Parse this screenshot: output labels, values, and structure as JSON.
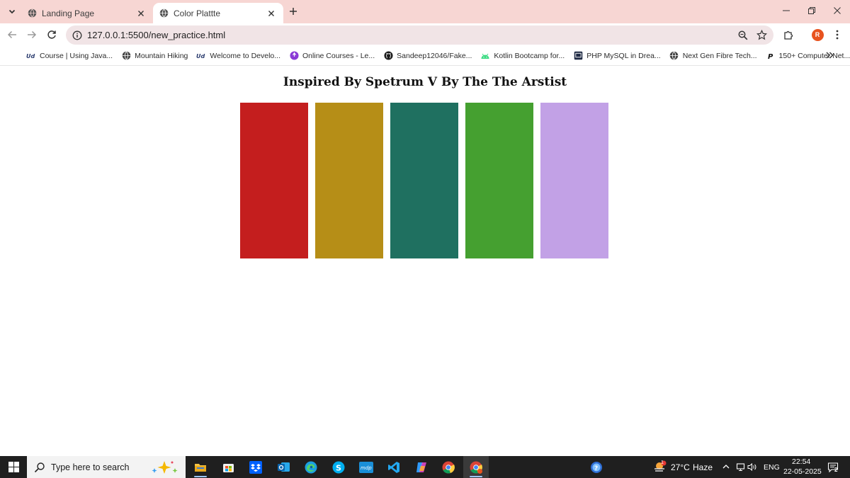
{
  "browser": {
    "tabs": [
      {
        "title": "Landing Page",
        "active": false
      },
      {
        "title": "Color Plattte",
        "active": true
      }
    ],
    "url": "127.0.0.1:5500/new_practice.html",
    "profile_initial": "R",
    "bookmarks": [
      {
        "label": "Course | Using Java...",
        "icon": "udemy-icon"
      },
      {
        "label": "Mountain Hiking",
        "icon": "globe-icon"
      },
      {
        "label": "Welcome to Develo...",
        "icon": "udemy-icon"
      },
      {
        "label": "Online Courses - Le...",
        "icon": "udemy-purple-icon"
      },
      {
        "label": "Sandeep12046/Fake...",
        "icon": "github-icon"
      },
      {
        "label": "Kotlin Bootcamp for...",
        "icon": "android-icon"
      },
      {
        "label": "PHP MySQL in Drea...",
        "icon": "screen-icon"
      },
      {
        "label": "Next Gen Fibre Tech...",
        "icon": "globe-icon"
      },
      {
        "label": "150+ Computer Net...",
        "icon": "p-icon"
      }
    ]
  },
  "page": {
    "title": "Inspired By Spetrum V By The The Arstist",
    "swatches": [
      {
        "color": "#c41e1e"
      },
      {
        "color": "#b68e17"
      },
      {
        "color": "#1f7060"
      },
      {
        "color": "#45a030"
      },
      {
        "color": "#c2a1e6"
      }
    ]
  },
  "taskbar": {
    "search_placeholder": "Type here to search",
    "weather_temp": "27°C",
    "weather_desc": "Haze",
    "weather_badge": "1",
    "language": "ENG",
    "time": "22:54",
    "date": "22-05-2025",
    "notification_count": "2"
  }
}
